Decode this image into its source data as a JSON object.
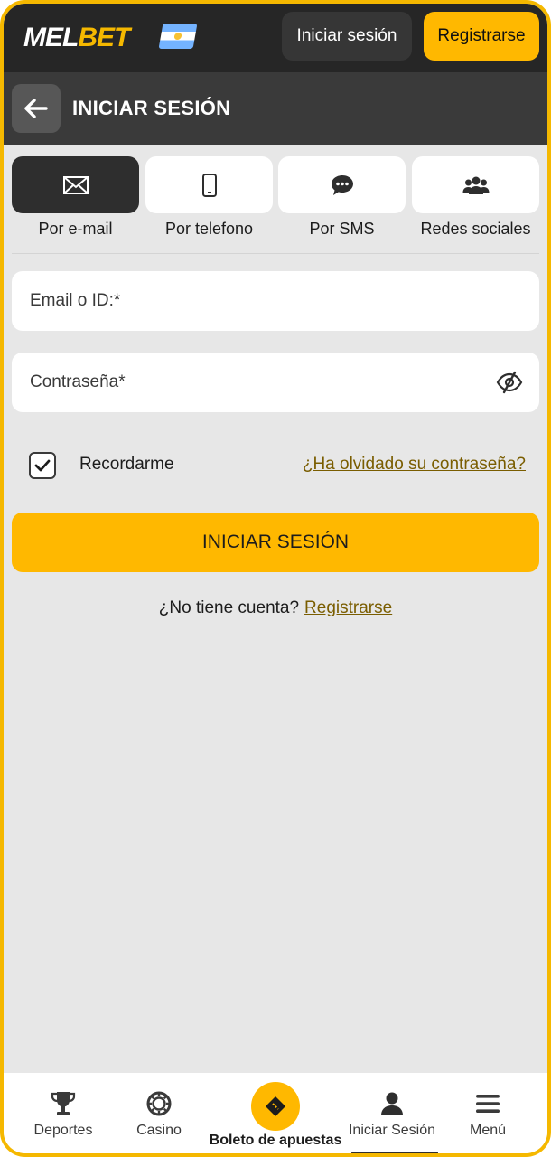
{
  "header": {
    "logo_part1": "MEL",
    "logo_part2": "BET",
    "login_button": "Iniciar sesión",
    "register_button": "Registrarse"
  },
  "section": {
    "title": "INICIAR SESIÓN"
  },
  "tabs": [
    {
      "label": "Por e-mail",
      "icon": "envelope-icon",
      "active": true
    },
    {
      "label": "Por telefono",
      "icon": "phone-icon",
      "active": false
    },
    {
      "label": "Por SMS",
      "icon": "chat-bubble-icon",
      "active": false
    },
    {
      "label": "Redes sociales",
      "icon": "users-icon",
      "active": false
    }
  ],
  "form": {
    "email_placeholder": "Email o ID:*",
    "password_placeholder": "Contraseña*",
    "remember_label": "Recordarme",
    "remember_checked": true,
    "forgot_link": "¿Ha olvidado su contraseña?",
    "submit_label": "INICIAR SESIÓN",
    "no_account_text": "¿No tiene cuenta?",
    "signup_link": "Registrarse"
  },
  "bottom_nav": [
    {
      "label": "Deportes",
      "icon": "trophy-icon"
    },
    {
      "label": "Casino",
      "icon": "casino-chip-icon"
    },
    {
      "label": "Boleto de apuestas",
      "icon": "ticket-icon"
    },
    {
      "label": "Iniciar Sesión",
      "icon": "user-icon"
    },
    {
      "label": "Menú",
      "icon": "menu-icon"
    }
  ],
  "colors": {
    "accent": "#ffb800",
    "header_bg": "#262626",
    "section_bg": "#3a3a3a",
    "page_bg": "#e7e7e7",
    "link": "#7a5d00"
  }
}
